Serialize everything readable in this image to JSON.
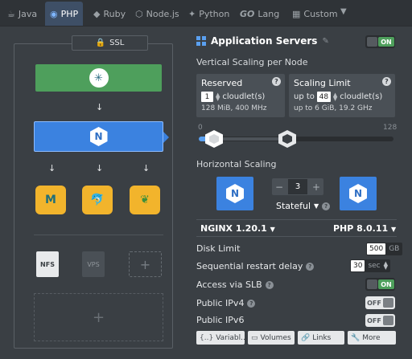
{
  "tabs": [
    {
      "label": "Java",
      "icon": "java-icon"
    },
    {
      "label": "PHP",
      "icon": "php-icon"
    },
    {
      "label": "Ruby",
      "icon": "ruby-icon"
    },
    {
      "label": "Node.js",
      "icon": "nodejs-icon"
    },
    {
      "label": "Python",
      "icon": "python-icon"
    },
    {
      "label": "Lang",
      "icon": "go-icon",
      "prefix": "GO"
    },
    {
      "label": "Custom",
      "icon": "custom-icon"
    }
  ],
  "topology": {
    "ssl_label": "SSL",
    "nfs_label": "NFS",
    "vps_label": "VPS",
    "add_symbol": "+"
  },
  "server": {
    "title": "Application Servers",
    "enabled_label": "ON",
    "vertical_label": "Vertical Scaling per Node",
    "reserved": {
      "title": "Reserved",
      "value": "1",
      "unit": "cloudlet(s)",
      "detail": "128 MiB, 400 MHz"
    },
    "limit": {
      "title": "Scaling Limit",
      "prefix": "up to",
      "value": "48",
      "unit": "cloudlet(s)",
      "detail": "up to 6 GiB, 19.2 GHz"
    },
    "slider": {
      "min_label": "0",
      "max_label": "128",
      "min": 0,
      "max": 128,
      "reserved": 1,
      "limit": 48
    },
    "horizontal_label": "Horizontal Scaling",
    "node_count": "3",
    "minus": "−",
    "plus": "+",
    "mode": "Stateful",
    "balancer_version": "NGINX 1.20.1",
    "app_version": "PHP 8.0.11"
  },
  "properties": {
    "disk_limit": {
      "label": "Disk Limit",
      "value": "500",
      "unit": "GB"
    },
    "restart_delay": {
      "label": "Sequential restart delay",
      "value": "30",
      "unit": "sec"
    },
    "slb": {
      "label": "Access via SLB",
      "state": "ON"
    },
    "ipv4": {
      "label": "Public IPv4",
      "state": "OFF"
    },
    "ipv6": {
      "label": "Public IPv6",
      "state": "OFF"
    }
  },
  "buttons": {
    "variables": "Variabl...",
    "volumes": "Volumes",
    "links": "Links",
    "more": "More"
  },
  "colors": {
    "accent": "#3b82e0",
    "success": "#4e9f5c",
    "database": "#f2b42c"
  }
}
